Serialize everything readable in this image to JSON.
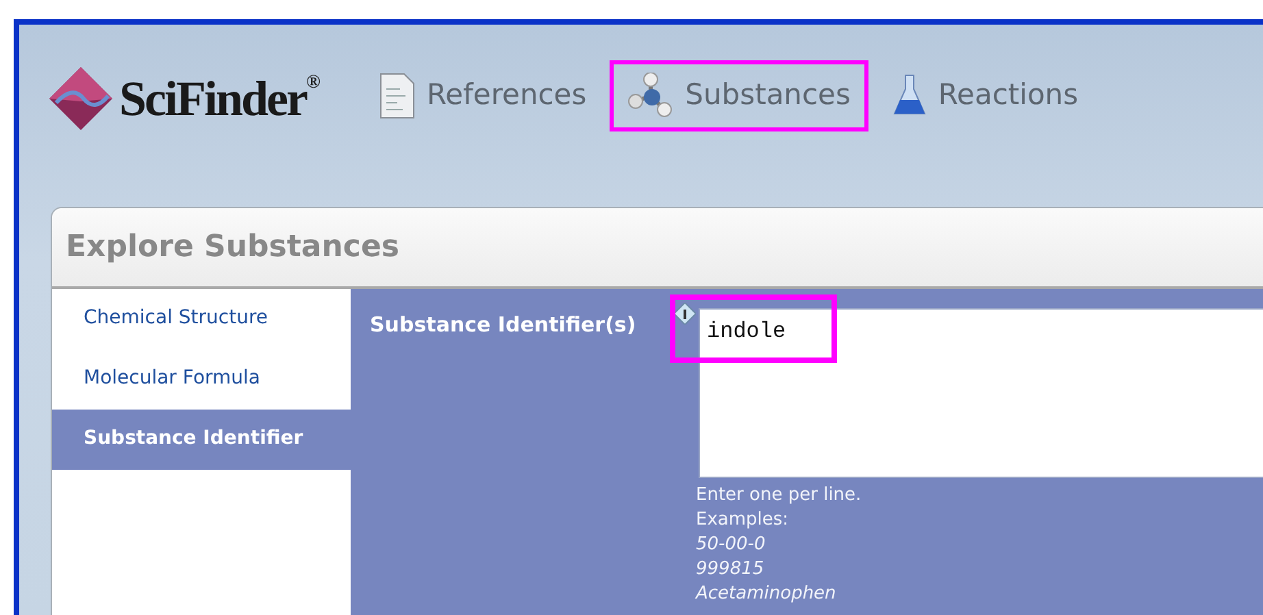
{
  "logo": {
    "name": "SciFinder",
    "mark": "®"
  },
  "tabs": [
    {
      "label": "References",
      "kind": "references",
      "highlighted": false
    },
    {
      "label": "Substances",
      "kind": "substances",
      "highlighted": true
    },
    {
      "label": "Reactions",
      "kind": "reactions",
      "highlighted": false
    }
  ],
  "panel": {
    "title": "Explore Substances",
    "sidebar": {
      "items": [
        {
          "label": "Chemical Structure",
          "selected": false
        },
        {
          "label": "Molecular Formula",
          "selected": false
        },
        {
          "label": "Substance Identifier",
          "selected": true
        }
      ]
    },
    "form": {
      "label": "Substance Identifier(s)",
      "value": "indole",
      "highlighted": true,
      "hint": "Enter one per line.",
      "examples_label": "Examples:",
      "examples": [
        "50-00-0",
        "999815",
        "Acetaminophen"
      ]
    }
  }
}
